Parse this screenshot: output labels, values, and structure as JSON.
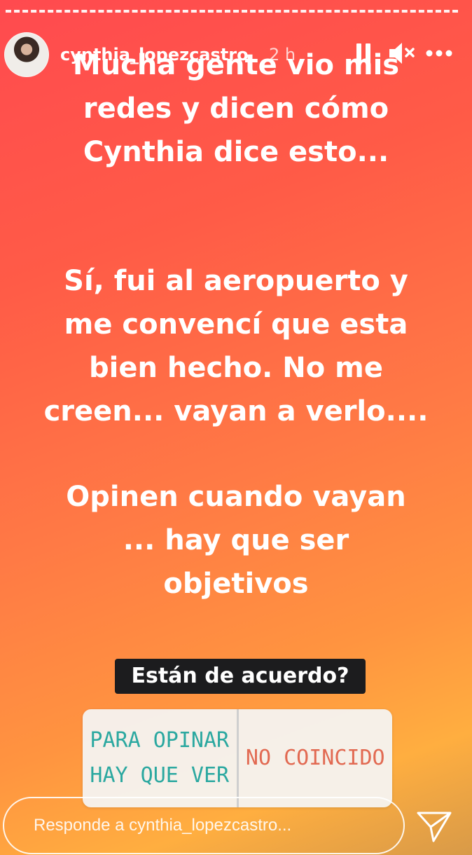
{
  "story": {
    "username": "cynthia_lopezcastro",
    "time": "2 h",
    "icons": {
      "pause": "pause-icon",
      "mute": "muted-speaker-icon",
      "more": "more-options-icon",
      "send": "send-icon"
    },
    "text_lines": [
      "Mucha gente vio mis",
      "redes y dicen cómo",
      "Cynthia dice esto...",
      "Sí, fui al aeropuerto y",
      "me convencí que esta",
      "bien hecho. No me",
      "creen... vayan a verlo....",
      "Opinen cuando vayan",
      "... hay que ser",
      "objetivos"
    ],
    "question": "Están de acuerdo?",
    "poll": {
      "option_1_line_1": "PARA OPINAR",
      "option_1_line_2": "HAY QUE VER",
      "option_2": "NO COINCIDO"
    },
    "reply_placeholder": "Responde a cynthia_lopezcastro..."
  }
}
